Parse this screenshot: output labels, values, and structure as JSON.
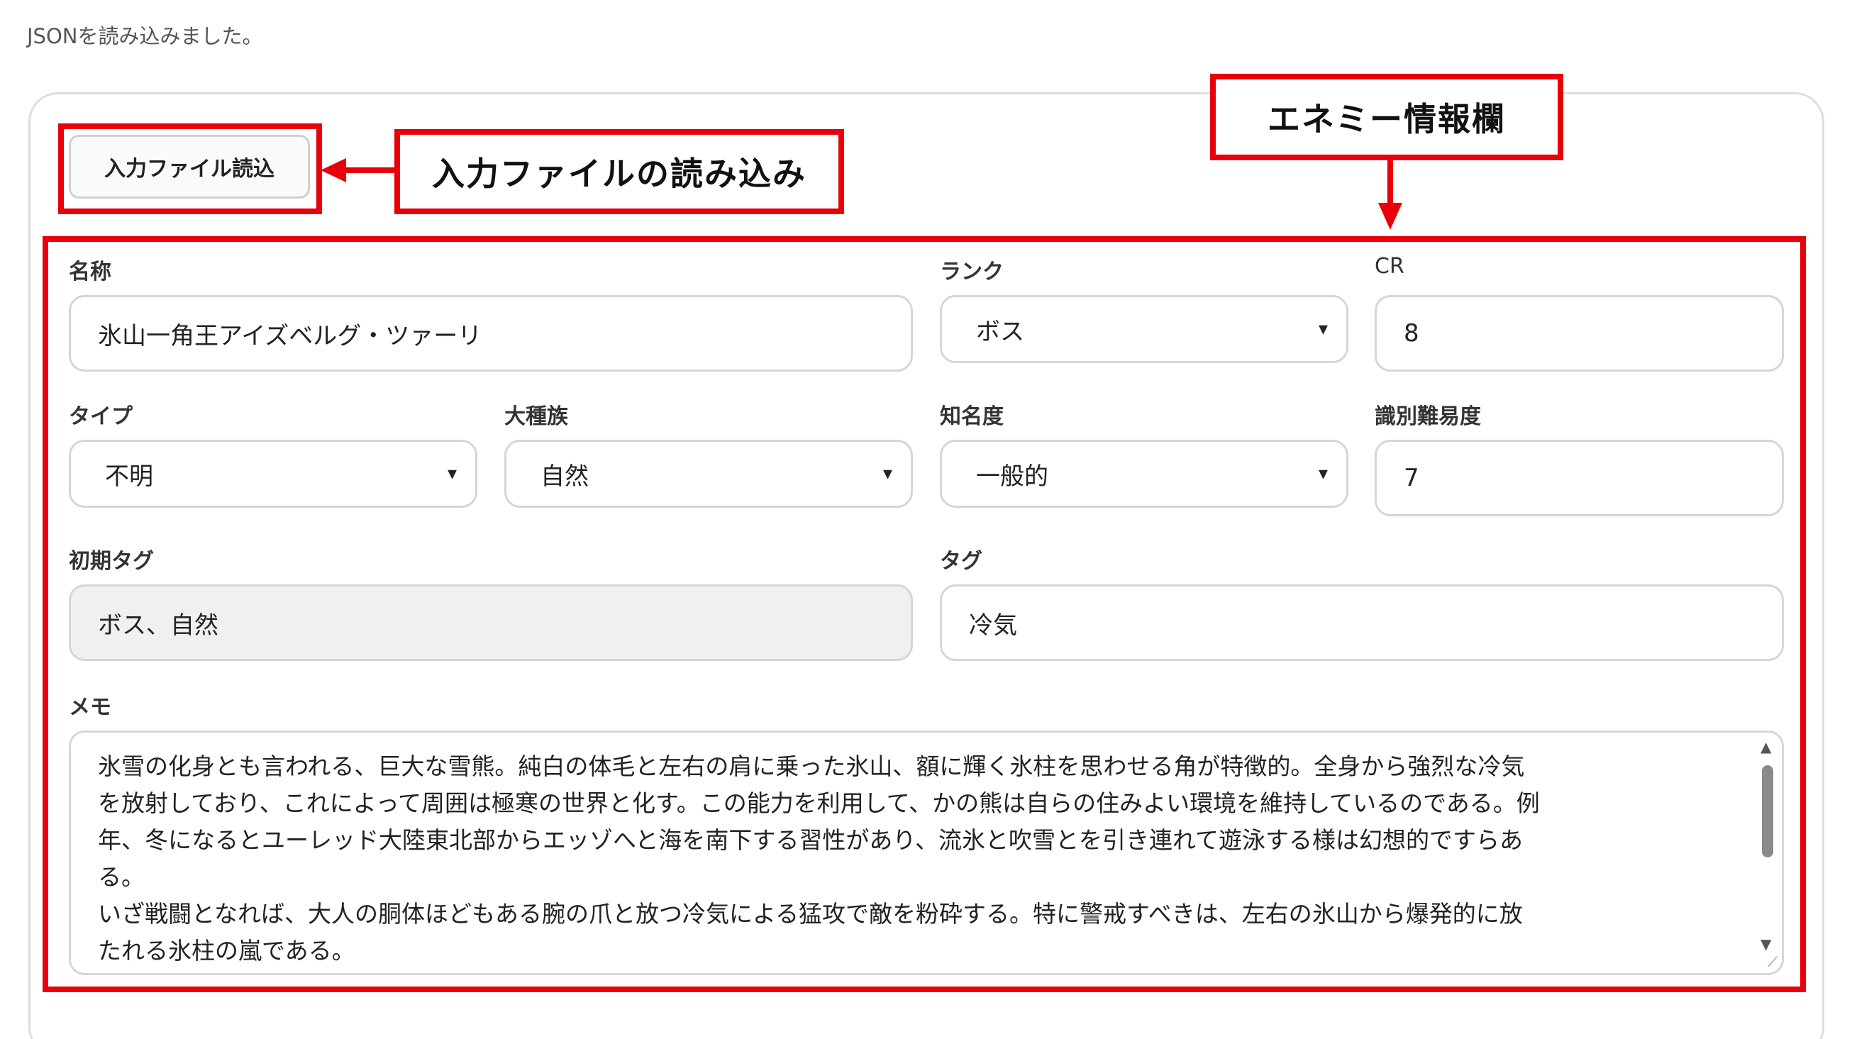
{
  "status_message": "JSONを読み込みました。",
  "load_button_label": "入力ファイル読込",
  "callouts": {
    "load": "入力ファイルの読み込み",
    "enemy_info": "エネミー情報欄"
  },
  "form": {
    "name": {
      "label": "名称",
      "value": "氷山一角王アイズベルグ・ツァーリ"
    },
    "rank": {
      "label": "ランク",
      "value": "ボス"
    },
    "cr": {
      "label": "CR",
      "value": "8"
    },
    "type": {
      "label": "タイプ",
      "value": "不明"
    },
    "race": {
      "label": "大種族",
      "value": "自然"
    },
    "fame": {
      "label": "知名度",
      "value": "一般的"
    },
    "id_difficulty": {
      "label": "識別難易度",
      "value": "7"
    },
    "initial_tags": {
      "label": "初期タグ",
      "value": "ボス、自然"
    },
    "tags": {
      "label": "タグ",
      "value": "冷気"
    },
    "memo": {
      "label": "メモ",
      "value": "氷雪の化身とも言われる、巨大な雪熊。純白の体毛と左右の肩に乗った氷山、額に輝く氷柱を思わせる角が特徴的。全身から強烈な冷気\nを放射しており、これによって周囲は極寒の世界と化す。この能力を利用して、かの熊は自らの住みよい環境を維持しているのである。例\n年、冬になるとユーレッド大陸東北部からエッゾへと海を南下する習性があり、流氷と吹雪とを引き連れて遊泳する様は幻想的ですらあ\nる。\nいざ戦闘となれば、大人の胴体ほどもある腕の爪と放つ冷気による猛攻で敵を粉砕する。特に警戒すべきは、左右の氷山から爆発的に放\nたれる氷柱の嵐である。"
    }
  },
  "icons": {
    "chevron": "▾",
    "scroll_up": "▲",
    "scroll_down": "▼",
    "resize": "⟋"
  },
  "colors": {
    "annotation_red": "#e8000b",
    "readonly_bg": "#f0f0f0"
  }
}
